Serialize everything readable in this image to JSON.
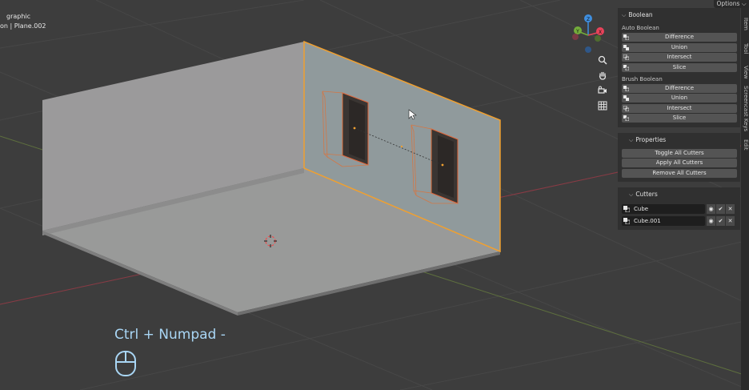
{
  "viewport": {
    "title_line1": "graphic",
    "title_line2": "on | Plane.002",
    "options_label": "Options",
    "side_tabs": [
      "Item",
      "Tool",
      "View",
      "Screencast Keys",
      "Edit"
    ],
    "shortcut_text": "Ctrl + Numpad -",
    "gizmo_axes": {
      "z": "Z",
      "y": "Y",
      "x": "X"
    },
    "nav_icons": [
      "zoom-icon",
      "hand-pan-icon",
      "camera-icon",
      "grid-icon"
    ]
  },
  "panel": {
    "boolean_header": "Boolean",
    "auto_label": "Auto Boolean",
    "auto_buttons": [
      "Difference",
      "Union",
      "Intersect",
      "Slice"
    ],
    "brush_label": "Brush Boolean",
    "brush_buttons": [
      "Difference",
      "Union",
      "Intersect",
      "Slice"
    ],
    "properties_header": "Properties",
    "properties_buttons": [
      "Toggle All Cutters",
      "Apply All Cutters",
      "Remove All Cutters"
    ],
    "cutters_header": "Cutters",
    "cutters": [
      "Cube",
      "Cube.001"
    ]
  },
  "colors": {
    "viewport_bg": "#3d3d3d",
    "panel_bg": "#303030",
    "button_bg": "#545454",
    "selection_orange": "#f0a030",
    "cutter_orange": "#e0663a",
    "shortcut_blue": "#a9d6f5",
    "axis_x": "#e8435a",
    "axis_y": "#74ad3b",
    "axis_z": "#3f8fe0"
  }
}
